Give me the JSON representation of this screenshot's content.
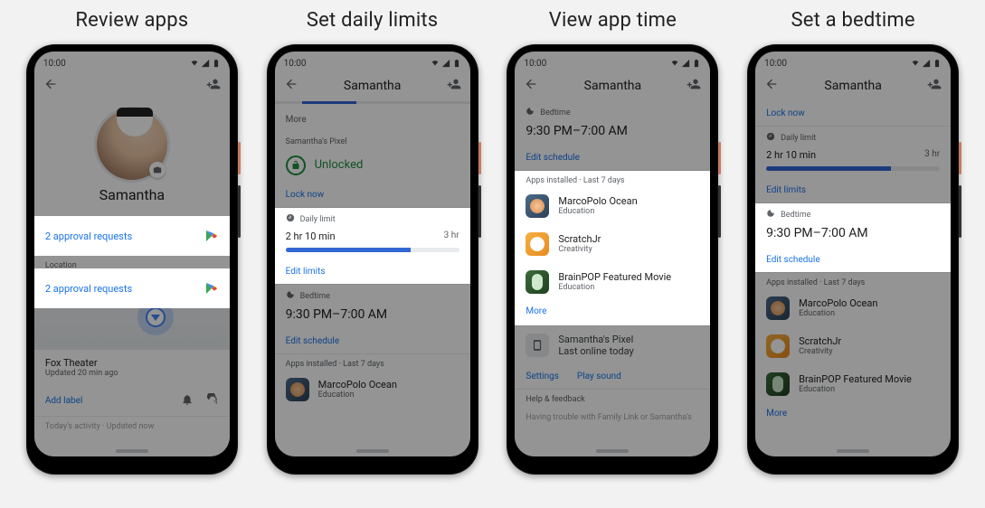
{
  "columns": [
    {
      "title": "Review apps"
    },
    {
      "title": "Set daily limits"
    },
    {
      "title": "View app time"
    },
    {
      "title": "Set a bedtime"
    }
  ],
  "status": {
    "time": "10:00"
  },
  "child_name": "Samantha",
  "phone1": {
    "approval_text": "2 approval requests",
    "location_label": "Location",
    "location_name": "Fox Theater",
    "location_updated": "Updated 20 min ago",
    "add_label": "Add label",
    "activity_footer": "Today's activity · Updated now"
  },
  "phone2": {
    "more": "More",
    "device_section": "Samantha's Pixel",
    "unlocked": "Unlocked",
    "lock_now": "Lock now",
    "daily_limit_label": "Daily limit",
    "used": "2 hr 10 min",
    "max": "3 hr",
    "edit_limits": "Edit limits",
    "bedtime_label": "Bedtime",
    "bedtime_time": "9:30 PM–7:00 AM",
    "edit_schedule": "Edit schedule",
    "apps_section": "Apps installed · Last 7 days",
    "app1_name": "MarcoPolo Ocean",
    "app1_cat": "Education"
  },
  "phone3": {
    "bedtime_label": "Bedtime",
    "bedtime_time": "9:30 PM–7:00 AM",
    "edit_schedule": "Edit schedule",
    "apps_section": "Apps installed · Last 7 days",
    "app1_name": "MarcoPolo Ocean",
    "app1_cat": "Education",
    "app2_name": "ScratchJr",
    "app2_cat": "Creativity",
    "app3_name": "BrainPOP Featured Movie",
    "app3_cat": "Education",
    "more": "More",
    "device_name": "Samantha's Pixel",
    "device_status": "Last online today",
    "settings": "Settings",
    "play_sound": "Play sound",
    "help_label": "Help & feedback",
    "trouble": "Having trouble with Family Link or Samantha's"
  },
  "phone4": {
    "lock_now": "Lock now",
    "daily_limit_label": "Daily limit",
    "used": "2 hr 10 min",
    "max": "3 hr",
    "edit_limits": "Edit limits",
    "bedtime_label": "Bedtime",
    "bedtime_time": "9:30 PM–7:00 AM",
    "edit_schedule": "Edit schedule",
    "apps_section": "Apps installed · Last 7 days",
    "app1_name": "MarcoPolo Ocean",
    "app1_cat": "Education",
    "app2_name": "ScratchJr",
    "app2_cat": "Creativity",
    "app3_name": "BrainPOP Featured Movie",
    "app3_cat": "Education",
    "more": "More"
  }
}
